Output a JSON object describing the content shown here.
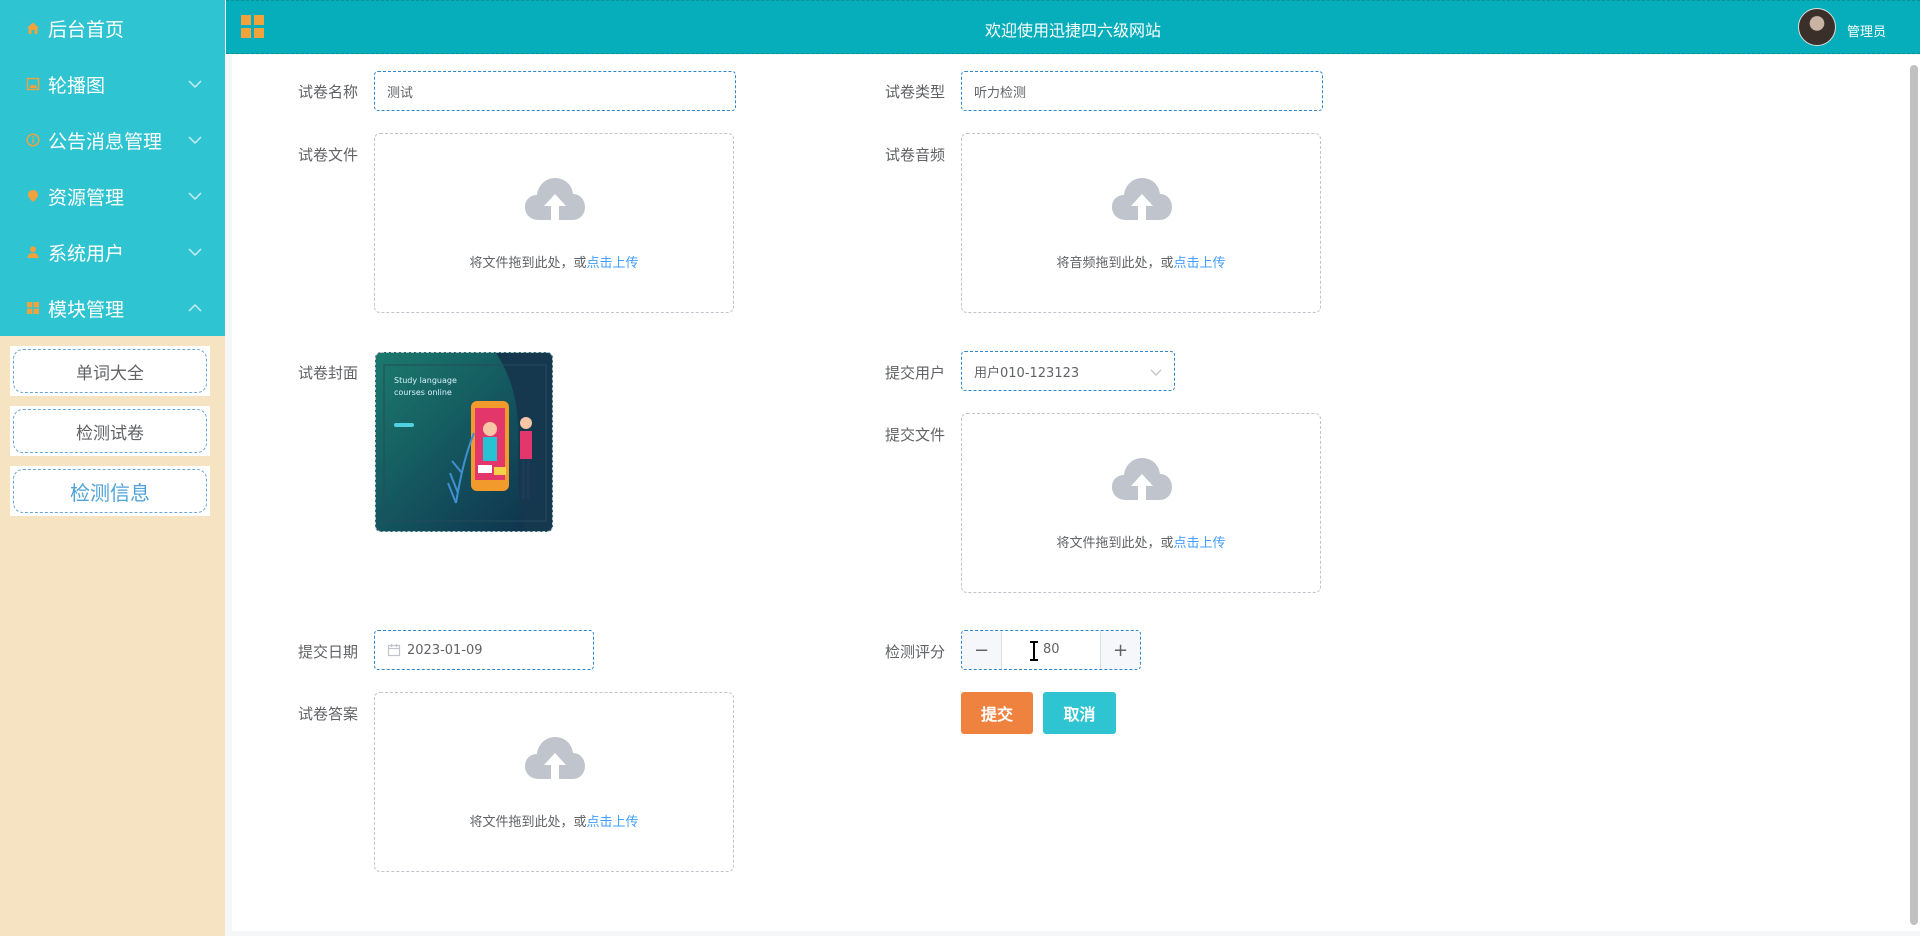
{
  "sidebar": {
    "items": [
      {
        "label": "后台首页",
        "icon": "home-icon"
      },
      {
        "label": "轮播图",
        "icon": "image-icon"
      },
      {
        "label": "公告消息管理",
        "icon": "info-icon"
      },
      {
        "label": "资源管理",
        "icon": "location-icon"
      },
      {
        "label": "系统用户",
        "icon": "user-icon"
      },
      {
        "label": "模块管理",
        "icon": "grid-icon"
      }
    ],
    "submenu": [
      {
        "label": "单词大全"
      },
      {
        "label": "检测试卷"
      },
      {
        "label": "检测信息"
      }
    ]
  },
  "header": {
    "title": "欢迎使用迅捷四六级网站",
    "user": "管理员"
  },
  "form": {
    "paper_name": {
      "label": "试卷名称",
      "value": "测试"
    },
    "paper_type": {
      "label": "试卷类型",
      "value": "听力检测"
    },
    "paper_file": {
      "label": "试卷文件",
      "hint": "将文件拖到此处，或",
      "link": "点击上传"
    },
    "paper_audio": {
      "label": "试卷音频",
      "hint": "将音频拖到此处，或",
      "link": "点击上传"
    },
    "paper_cover": {
      "label": "试卷封面",
      "text1": "Study language",
      "text2": "courses online"
    },
    "submit_user": {
      "label": "提交用户",
      "value": "用户010-123123"
    },
    "submit_file": {
      "label": "提交文件",
      "hint": "将文件拖到此处，或",
      "link": "点击上传"
    },
    "submit_date": {
      "label": "提交日期",
      "value": "2023-01-09"
    },
    "score": {
      "label": "检测评分",
      "value": "80"
    },
    "paper_answer": {
      "label": "试卷答案",
      "hint": "将文件拖到此处，或",
      "link": "点击上传"
    }
  },
  "actions": {
    "submit": "提交",
    "cancel": "取消"
  },
  "colors": {
    "sidebar_menu": "#2fc4d1",
    "sidebar_bg": "#f5e3c1",
    "header": "#06aebb",
    "submit_button": "#f08240",
    "cancel_button": "#2fc4d1",
    "link": "#409eff"
  }
}
